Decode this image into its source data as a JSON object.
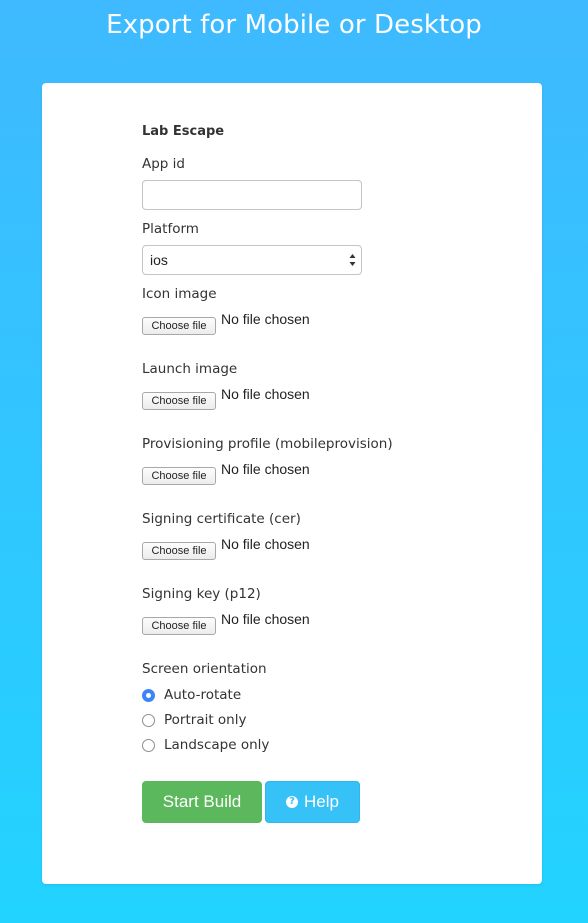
{
  "page": {
    "title": "Export for Mobile or Desktop"
  },
  "form": {
    "app_name": "Lab Escape",
    "app_id": {
      "label": "App id",
      "value": "",
      "placeholder": ""
    },
    "platform": {
      "label": "Platform",
      "selected": "ios"
    },
    "file_fields": [
      {
        "label": "Icon image",
        "button": "Choose file",
        "status": "No file chosen"
      },
      {
        "label": "Launch image",
        "button": "Choose file",
        "status": "No file chosen"
      },
      {
        "label": "Provisioning profile (mobileprovision)",
        "button": "Choose file",
        "status": "No file chosen"
      },
      {
        "label": "Signing certificate (cer)",
        "button": "Choose file",
        "status": "No file chosen"
      },
      {
        "label": "Signing key (p12)",
        "button": "Choose file",
        "status": "No file chosen"
      }
    ],
    "orientation": {
      "label": "Screen orientation",
      "options": [
        {
          "label": "Auto-rotate",
          "checked": true
        },
        {
          "label": "Portrait only",
          "checked": false
        },
        {
          "label": "Landscape only",
          "checked": false
        }
      ]
    },
    "buttons": {
      "start_build": "Start Build",
      "help": "Help",
      "help_icon_glyph": "?"
    }
  },
  "colors": {
    "background_top": "#3fb9ff",
    "background_bottom": "#22d3ff",
    "start_button": "#5cb85c",
    "help_button": "#36c2f7",
    "radio_checked": "#3a86f8"
  }
}
